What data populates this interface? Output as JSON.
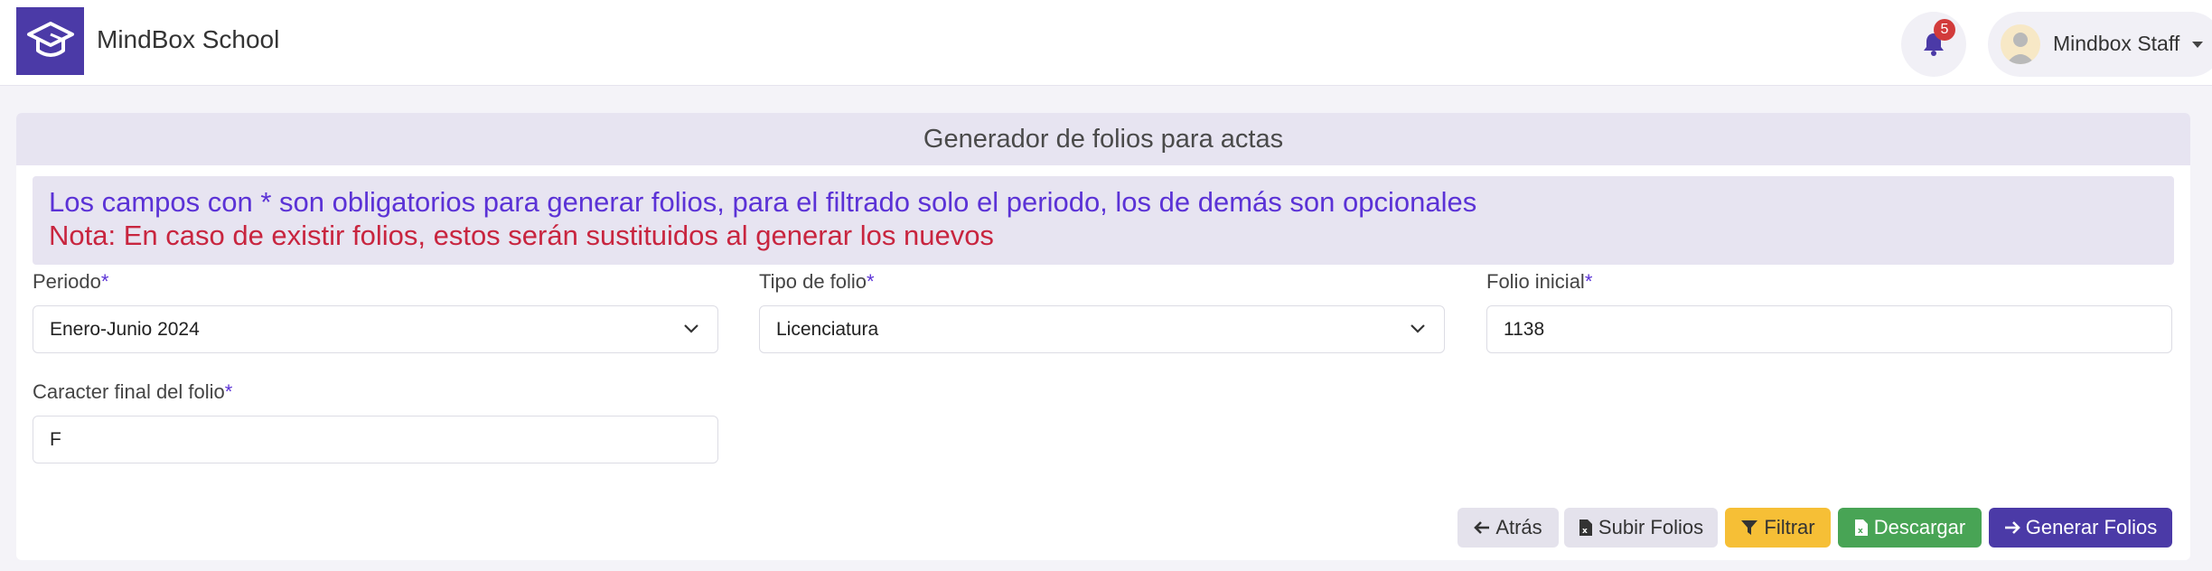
{
  "app": {
    "name": "MindBox School"
  },
  "header": {
    "notifications_count": "5",
    "user_name": "Mindbox Staff"
  },
  "card": {
    "title": "Generador de folios para actas",
    "notice_line1": "Los campos con * son obligatorios para generar folios, para el filtrado solo el periodo, los de demás son opcionales",
    "notice_line2": "Nota: En caso de existir folios, estos serán sustituidos al generar los nuevos"
  },
  "form": {
    "periodo": {
      "label": "Periodo",
      "required_mark": "*",
      "value": "Enero-Junio 2024"
    },
    "tipo_folio": {
      "label": "Tipo de folio",
      "required_mark": "*",
      "value": "Licenciatura"
    },
    "folio_inicial": {
      "label": "Folio inicial",
      "required_mark": "*",
      "value": "1138"
    },
    "caracter_final": {
      "label": "Caracter final del folio",
      "required_mark": "*",
      "value": "F"
    }
  },
  "actions": {
    "back": "Atrás",
    "upload": "Subir Folios",
    "filter": "Filtrar",
    "download": "Descargar",
    "generate": "Generar Folios"
  },
  "icons": {
    "logo": "graduation-cap-icon",
    "bell": "bell-icon",
    "back": "arrow-left-icon",
    "upload": "excel-file-icon",
    "filter": "filter-icon",
    "download": "excel-file-icon",
    "generate": "arrow-right-icon"
  },
  "colors": {
    "brand": "#4b3aa7",
    "required": "#5b32d6",
    "warning_text": "#c8253f",
    "filter_button": "#f6bf36",
    "download_button": "#48a455",
    "badge": "#d23b3b"
  }
}
